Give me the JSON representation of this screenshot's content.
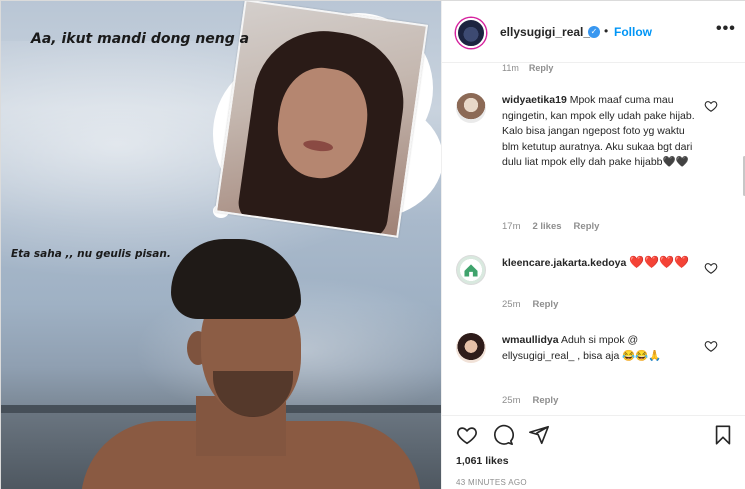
{
  "post": {
    "image_caption_top": "Aa, ikut mandi dong neng a",
    "image_caption_bottom": "Eta saha ,, nu geulis pisan."
  },
  "header": {
    "username": "ellysugigi_real_",
    "verified_icon": "verified-badge-icon",
    "bullet": "•",
    "follow_label": "Follow",
    "more_label": "•••"
  },
  "comments": {
    "cut_time": "11m",
    "cut_reply": "Reply",
    "items": [
      {
        "username": "widyaetika19",
        "text": "Mpok maaf cuma mau ngingetin, kan mpok elly udah pake hijab. Kalo bisa jangan ngepost foto yg waktu blm ketutup auratnya. Aku sukaa bgt dari dulu liat mpok elly dah pake hijabb",
        "emoji": "🖤🖤",
        "time": "17m",
        "likes": "2 likes",
        "reply": "Reply"
      },
      {
        "username": "kleencare.jakarta.kedoya",
        "text": "",
        "emoji": "❤️❤️❤️❤️",
        "time": "25m",
        "likes": "",
        "reply": "Reply"
      },
      {
        "username": "wmaullidya",
        "text": "Aduh si mpok @ ellysugigi_real_ , bisa aja",
        "emoji": "😂😂🙏",
        "time": "25m",
        "likes": "",
        "reply": "Reply"
      }
    ]
  },
  "actions": {
    "like_icon": "heart-icon",
    "comment_icon": "comment-icon",
    "share_icon": "share-icon",
    "save_icon": "bookmark-icon",
    "likes_count": "1,061 likes",
    "posted_time": "43 MINUTES AGO"
  },
  "colors": {
    "link_blue": "#0095f6",
    "verified_blue": "#3897f0",
    "muted": "#8e8e8e",
    "text": "#262626"
  }
}
